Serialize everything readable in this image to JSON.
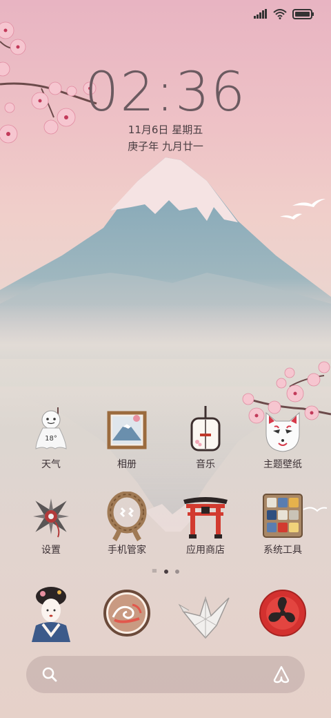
{
  "status_bar": {
    "icons": [
      "signal-icon",
      "wifi-icon",
      "battery-icon"
    ]
  },
  "clock": {
    "time": "02:36",
    "date": "11月6日 星期五",
    "lunar": "庚子年 九月廿一"
  },
  "apps_row1": [
    {
      "label": "天气",
      "icon": "weather-doll-icon",
      "temp": "18°"
    },
    {
      "label": "相册",
      "icon": "gallery-icon"
    },
    {
      "label": "音乐",
      "icon": "music-shamisen-icon"
    },
    {
      "label": "主题壁纸",
      "icon": "kitsune-mask-icon"
    }
  ],
  "apps_row2": [
    {
      "label": "设置",
      "icon": "shuriken-settings-icon"
    },
    {
      "label": "手机管家",
      "icon": "rope-security-icon"
    },
    {
      "label": "应用商店",
      "icon": "torii-store-icon"
    },
    {
      "label": "系统工具",
      "icon": "toolbox-icon"
    }
  ],
  "page_indicator": {
    "pages": 2,
    "active": 0
  },
  "dock": [
    {
      "icon": "geisha-phone-icon"
    },
    {
      "icon": "wave-messages-icon"
    },
    {
      "icon": "paper-crane-browser-icon"
    },
    {
      "icon": "tomoe-camera-icon"
    }
  ],
  "colors": {
    "sky_top": "#e8b4c2",
    "mountain": "#7fa3b3",
    "snow": "#f6e6e6",
    "text": "#3d3236",
    "clock": "#6b5a60"
  }
}
